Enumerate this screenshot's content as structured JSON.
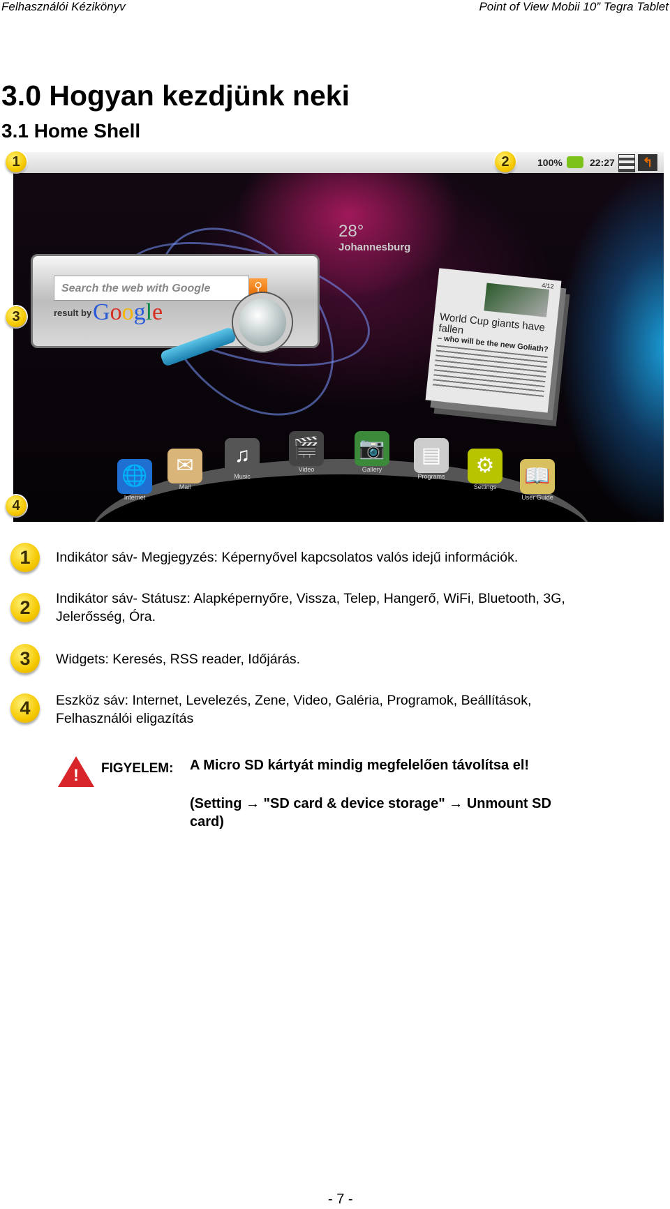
{
  "header": {
    "left": "Felhasználói Kézikönyv",
    "right": "Point of View Mobii 10” Tegra Tablet"
  },
  "title": "3.0 Hogyan kezdjünk neki",
  "subtitle": "3.1 Home Shell",
  "screenshot": {
    "status": {
      "battery": "100%",
      "time": "22:27",
      "battery_color": "#7cc21a",
      "back_color": "#e56b00"
    },
    "search_widget": {
      "placeholder": "Search the web with Google",
      "result_by": "result by",
      "logo": "Google"
    },
    "weather": {
      "temp": "28°",
      "city": "Johannesburg"
    },
    "news": {
      "page": "4/12",
      "headline": "World Cup giants have fallen",
      "sub": "– who will be the new Goliath?"
    },
    "dock": [
      {
        "label": "Internet",
        "icon": "globe-icon"
      },
      {
        "label": "Mail",
        "icon": "mail-icon"
      },
      {
        "label": "Music",
        "icon": "music-icon"
      },
      {
        "label": "Video",
        "icon": "video-icon"
      },
      {
        "label": "Gallery",
        "icon": "camera-icon"
      },
      {
        "label": "Programs",
        "icon": "programs-icon"
      },
      {
        "label": "Settings",
        "icon": "gear-icon"
      },
      {
        "label": "User Guide",
        "icon": "book-icon"
      }
    ],
    "badges": [
      "1",
      "2",
      "3",
      "4"
    ]
  },
  "items": [
    {
      "num": "1",
      "line1": "Indikátor sáv- Megjegyzés: Képernyővel kapcsolatos valós idejű információk.",
      "line2": ""
    },
    {
      "num": "2",
      "line1": "Indikátor sáv- Státusz: Alapképernyőre, Vissza, Telep, Hangerő, WiFi, Bluetooth, 3G,",
      "line2": "Jelerősség, Óra."
    },
    {
      "num": "3",
      "line1": "Widgets: Keresés, RSS reader, Időjárás.",
      "line2": ""
    },
    {
      "num": "4",
      "line1": "Eszköz sáv: Internet, Levelezés, Zene, Video, Galéria, Programok, Beállítások,",
      "line2": "Felhasználói eligazítás"
    }
  ],
  "warning": {
    "label": "FIGYELEM:",
    "text": "A Micro SD kártyát mindig megfelelően távolítsa el!",
    "path_line1": "(Setting → \"SD card & device storage\" → Unmount SD",
    "path_line2": "card)",
    "icon_color": "#d8252a"
  },
  "page_number": "- 7 -"
}
